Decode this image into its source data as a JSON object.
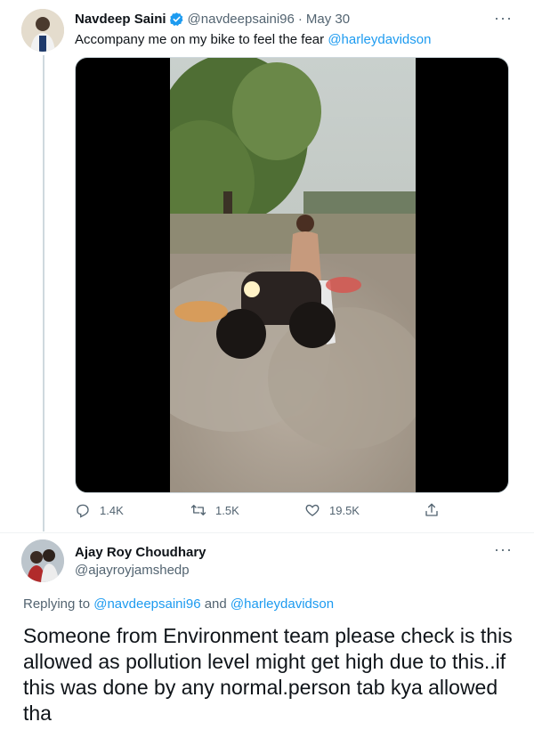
{
  "tweet": {
    "author_name": "Navdeep Saini",
    "handle": "@navdeepsaini96",
    "separator": "·",
    "date": "May 30",
    "text": "Accompany me on my bike to feel the fear ",
    "mention": "@harleydavidson",
    "more": "···",
    "stats": {
      "replies": "1.4K",
      "retweets": "1.5K",
      "likes": "19.5K"
    },
    "icons": [
      "reply-icon",
      "retweet-icon",
      "like-icon",
      "share-icon",
      "verified-badge-icon"
    ]
  },
  "reply": {
    "author_name": "Ajay Roy Choudhary",
    "handle": "@ajayroyjamshedp",
    "more": "···",
    "replying_prefix": "Replying to ",
    "replying_to_1": "@navdeepsaini96",
    "replying_and": " and ",
    "replying_to_2": "@harleydavidson",
    "text": "Someone from Environment team please check is this allowed as pollution level might get high due to this..if this was done by any normal.person tab kya allowed tha"
  },
  "colors": {
    "accent": "#1d9bf0",
    "text": "#0f1419",
    "secondary": "#536471",
    "border": "#cfd9de"
  }
}
